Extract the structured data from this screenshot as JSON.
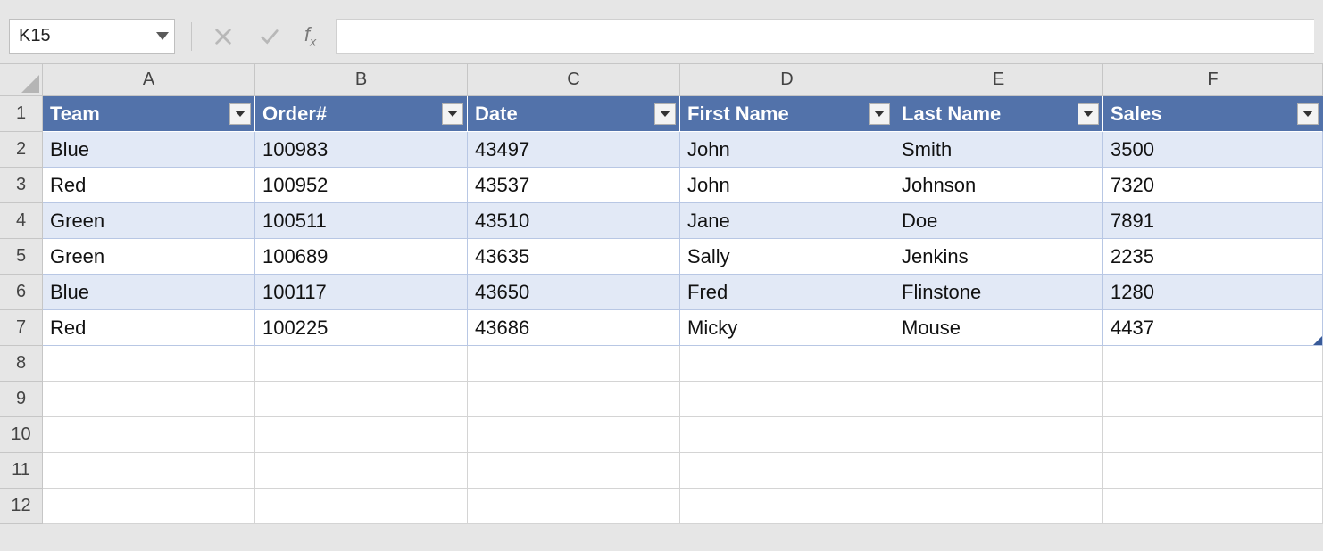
{
  "formula_bar": {
    "name_box_value": "K15",
    "formula_value": ""
  },
  "columns": [
    "A",
    "B",
    "C",
    "D",
    "E",
    "F"
  ],
  "row_numbers": [
    "1",
    "2",
    "3",
    "4",
    "5",
    "6",
    "7",
    "8",
    "9",
    "10",
    "11",
    "12"
  ],
  "table": {
    "headers": [
      "Team",
      "Order#",
      "Date",
      "First Name",
      "Last Name",
      "Sales"
    ],
    "rows": [
      {
        "team": "Blue",
        "order": "100983",
        "date": "43497",
        "first": "John",
        "last": "Smith",
        "sales": "3500"
      },
      {
        "team": "Red",
        "order": "100952",
        "date": "43537",
        "first": "John",
        "last": "Johnson",
        "sales": "7320"
      },
      {
        "team": "Green",
        "order": "100511",
        "date": "43510",
        "first": "Jane",
        "last": "Doe",
        "sales": "7891"
      },
      {
        "team": "Green",
        "order": "100689",
        "date": "43635",
        "first": "Sally",
        "last": "Jenkins",
        "sales": "2235"
      },
      {
        "team": "Blue",
        "order": "100117",
        "date": "43650",
        "first": "Fred",
        "last": "Flinstone",
        "sales": "1280"
      },
      {
        "team": "Red",
        "order": "100225",
        "date": "43686",
        "first": "Micky",
        "last": "Mouse",
        "sales": "4437"
      }
    ]
  }
}
